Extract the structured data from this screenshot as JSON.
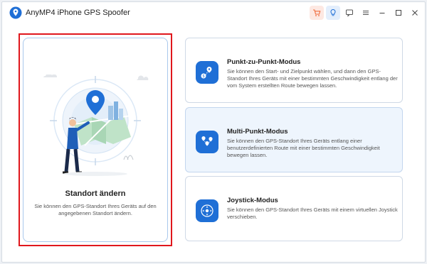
{
  "app": {
    "title": "AnyMP4 iPhone GPS Spoofer"
  },
  "colors": {
    "accent": "#1f6fd6",
    "highlight": "#e0171d",
    "cart": "#f06a3a"
  },
  "titlebar_icons": [
    "cart-icon",
    "lightbulb-icon",
    "feedback-icon",
    "menu-icon",
    "minimize-icon",
    "maximize-icon",
    "close-icon"
  ],
  "main_card": {
    "title": "Standort ändern",
    "description": "Sie können den GPS-Standort Ihres Geräts auf den angegebenen Standort ändern."
  },
  "modes": [
    {
      "title": "Punkt-zu-Punkt-Modus",
      "description": "Sie können den Start- und Zielpunkt wählen, und dann den GPS-Standort Ihres Geräts mit einer bestimmten Geschwindigkeit entlang der vom System erstellten Route bewegen lassen.",
      "icon": "route-icon"
    },
    {
      "title": "Multi-Punkt-Modus",
      "description": "Sie können den GPS-Standort Ihres Geräts entlang einer benutzerdefinierten Route mit einer bestimmten Geschwindigkeit bewegen lassen.",
      "icon": "multi-pin-icon"
    },
    {
      "title": "Joystick-Modus",
      "description": "Sie können den GPS-Standort Ihres Geräts mit einem virtuellen Joystick verschieben.",
      "icon": "joystick-icon"
    }
  ]
}
